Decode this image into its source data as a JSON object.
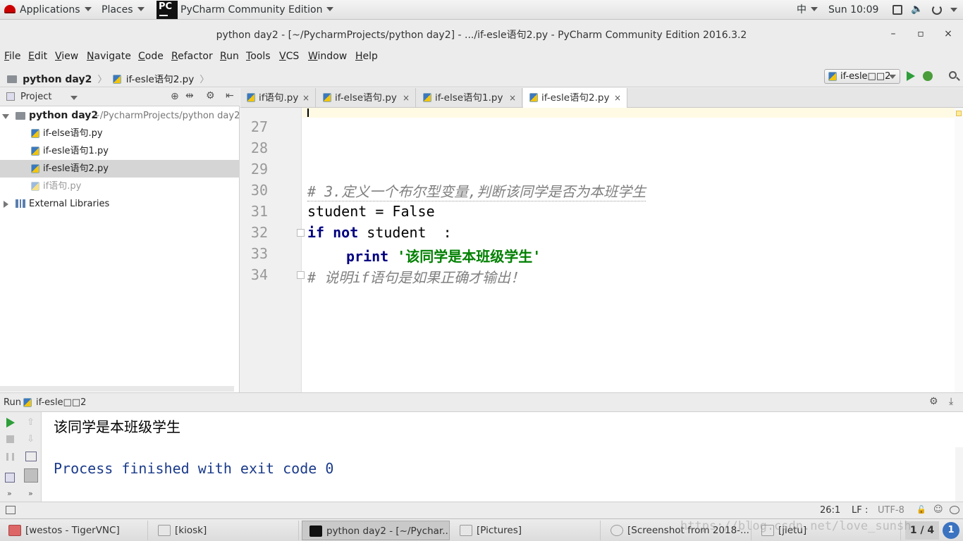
{
  "topbar": {
    "applications": "Applications",
    "places": "Places",
    "app_name": "PyCharm Community Edition",
    "input_method": "中",
    "clock": "Sun 10:09"
  },
  "window": {
    "title": "python day2 - [~/PycharmProjects/python day2] - .../if-esle语句2.py - PyCharm Community Edition 2016.3.2",
    "minimize": "–",
    "maximize": "▫",
    "close": "×"
  },
  "menu": [
    "File",
    "Edit",
    "View",
    "Navigate",
    "Code",
    "Refactor",
    "Run",
    "Tools",
    "VCS",
    "Window",
    "Help"
  ],
  "breadcrumb": {
    "project": "python day2",
    "file": "if-esle语句2.py"
  },
  "run_config": {
    "label": "if-esle□□2"
  },
  "project_panel": {
    "title": "Project",
    "root_name": "python day2",
    "root_path": "~/PycharmProjects/python day2",
    "files": [
      "if-else语句.py",
      "if-esle语句1.py",
      "if-esle语句2.py",
      "if语句.py"
    ],
    "external": "External Libraries"
  },
  "tabs": [
    {
      "label": "if语句.py",
      "close": "×"
    },
    {
      "label": "if-else语句.py",
      "close": "×"
    },
    {
      "label": "if-else语句1.py",
      "close": "×"
    },
    {
      "label": "if-esle语句2.py",
      "close": "×"
    }
  ],
  "editor": {
    "lines": [
      {
        "num": "27",
        "code": ""
      },
      {
        "num": "28",
        "code": ""
      },
      {
        "num": "29",
        "code": ""
      },
      {
        "num": "30",
        "comment": "# 3.定义一个布尔型变量,判断该同学是否为本班学生"
      },
      {
        "num": "31",
        "code": "student = False"
      },
      {
        "num": "32",
        "kw1": "if",
        "kw2": "not",
        "rest": " student  :"
      },
      {
        "num": "33",
        "kw": "print",
        "str": "'该同学是本班级学生'"
      },
      {
        "num": "34",
        "comment": "# 说明if语句是如果正确才输出！"
      }
    ]
  },
  "run_panel": {
    "label": "Run",
    "config": "if-esle□□2",
    "output": [
      "该同学是本班级学生",
      "Process finished with exit code 0"
    ]
  },
  "statusbar": {
    "position": "26:1",
    "line_sep": "LF",
    "encoding": "UTF-8"
  },
  "taskbar": {
    "items": [
      "[westos - TigerVNC]",
      "[kiosk]",
      "python day2 - [~/Pychar...",
      "[Pictures]",
      "[Screenshot from 2018-...",
      "[jietu]"
    ],
    "workspace": "1 / 4",
    "badge": "1",
    "watermark": "https://blog.csdn.net/love_sunsh"
  },
  "colors": {
    "keyword": "#000080",
    "string": "#008000",
    "comment": "#808080",
    "console_text": "#1a3a8a"
  }
}
